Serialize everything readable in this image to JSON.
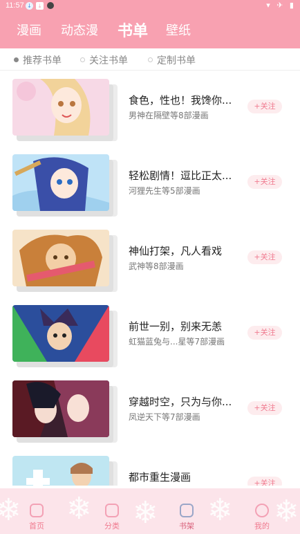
{
  "status": {
    "time": "11:57",
    "right_icons": "▾ ✈ ▮"
  },
  "tabs": [
    {
      "label": "漫画"
    },
    {
      "label": "动态漫"
    },
    {
      "label": "书单"
    },
    {
      "label": "壁纸"
    }
  ],
  "subtabs": [
    {
      "label": "推荐书单"
    },
    {
      "label": "关注书单"
    },
    {
      "label": "定制书单"
    }
  ],
  "items": [
    {
      "title": "食色，性也！我馋你...",
      "subtitle": "男神在隔壁等8部漫画",
      "follow": "+关注"
    },
    {
      "title": "轻松剧情！逗比正太...",
      "subtitle": "河狸先生等5部漫画",
      "follow": "+关注"
    },
    {
      "title": "神仙打架，凡人看戏",
      "subtitle": "武神等8部漫画",
      "follow": "+关注"
    },
    {
      "title": "前世一别，别来无恙",
      "subtitle": "虹猫蓝兔与...星等7部漫画",
      "follow": "+关注"
    },
    {
      "title": "穿越时空，只为与你...",
      "subtitle": "凤逆天下等7部漫画",
      "follow": "+关注"
    },
    {
      "title": "都市重生漫画",
      "subtitle": "",
      "follow": "+关注"
    }
  ],
  "nav": [
    {
      "label": "首页",
      "icon": "home-icon"
    },
    {
      "label": "分类",
      "icon": "dress-icon"
    },
    {
      "label": "书架",
      "icon": "bookshelf-icon"
    },
    {
      "label": "我的",
      "icon": "profile-icon"
    }
  ],
  "colors": {
    "header": "#f8a1b1",
    "accent": "#f07b90",
    "bottom_bg": "#fce4ea"
  }
}
